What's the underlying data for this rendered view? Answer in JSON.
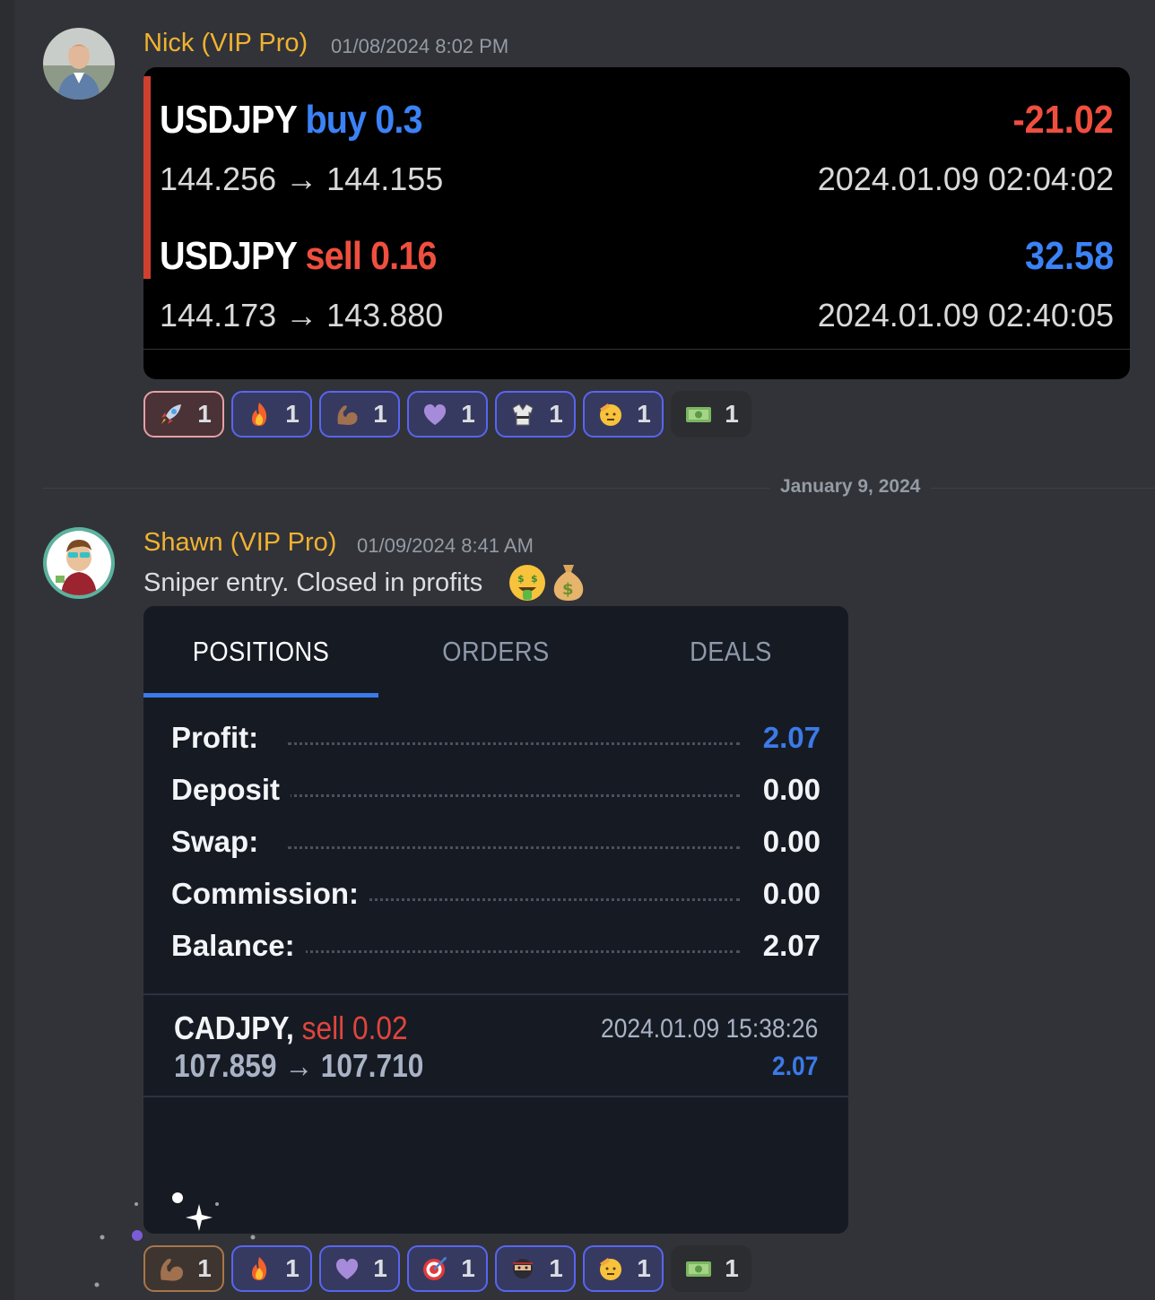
{
  "messages": [
    {
      "author": "Nick (VIP Pro)",
      "timestamp": "01/08/2024 8:02 PM",
      "trades": [
        {
          "symbol": "USDJPY",
          "side": "buy",
          "volume": "0.3",
          "pnl": "-21.02",
          "pnl_color": "#ef4f3f",
          "prices": "144.256 → 144.155",
          "time": "2024.01.09 02:04:02"
        },
        {
          "symbol": "USDJPY",
          "side": "sell",
          "volume": "0.16",
          "pnl": "32.58",
          "pnl_color": "#3b82f6",
          "prices": "144.173 → 143.880",
          "time": "2024.01.09 02:40:05"
        }
      ],
      "reactions": [
        {
          "emoji": "rocket-emoji",
          "count": "1"
        },
        {
          "emoji": "fire-emoji",
          "count": "1"
        },
        {
          "emoji": "flexed-biceps-emoji",
          "count": "1"
        },
        {
          "emoji": "purple-heart-emoji",
          "count": "1"
        },
        {
          "emoji": "martial-arts-uniform-emoji",
          "count": "1"
        },
        {
          "emoji": "saluting-face-emoji",
          "count": "1"
        },
        {
          "emoji": "dollar-banknote-emoji",
          "count": "1"
        }
      ]
    },
    {
      "author": "Shawn (VIP Pro)",
      "timestamp": "01/09/2024 8:41 AM",
      "text": "Sniper entry. Closed in profits",
      "text_emojis": [
        "money-mouth-face-emoji",
        "money-bag-emoji"
      ],
      "mt_panel": {
        "tabs": [
          "POSITIONS",
          "ORDERS",
          "DEALS"
        ],
        "active_tab": "POSITIONS",
        "summary": [
          {
            "label": "Profit:",
            "value": "2.07",
            "color": "#3b7ae8"
          },
          {
            "label": "Deposit",
            "value": "0.00",
            "color": "#f2f4f7"
          },
          {
            "label": "Swap:",
            "value": "0.00",
            "color": "#f2f4f7"
          },
          {
            "label": "Commission:",
            "value": "0.00",
            "color": "#f2f4f7"
          },
          {
            "label": "Balance:",
            "value": "2.07",
            "color": "#f2f4f7"
          }
        ],
        "position": {
          "symbol": "CADJPY,",
          "side": "sell",
          "volume": "0.02",
          "prices": "107.859 → 107.710",
          "time": "2024.01.09 15:38:26",
          "profit": "2.07"
        }
      },
      "reactions": [
        {
          "emoji": "flexed-biceps-emoji",
          "count": "1"
        },
        {
          "emoji": "fire-emoji",
          "count": "1"
        },
        {
          "emoji": "purple-heart-emoji",
          "count": "1"
        },
        {
          "emoji": "direct-hit-emoji",
          "count": "1"
        },
        {
          "emoji": "ninja-emoji",
          "count": "1"
        },
        {
          "emoji": "saluting-face-emoji",
          "count": "1"
        },
        {
          "emoji": "dollar-banknote-emoji",
          "count": "1"
        }
      ]
    }
  ],
  "date_divider": "January 9, 2024",
  "colors": {
    "username": "#f0b232",
    "background": "#313338",
    "accent_blue": "#3b7ae8",
    "sell_red": "#ef4f3f"
  }
}
